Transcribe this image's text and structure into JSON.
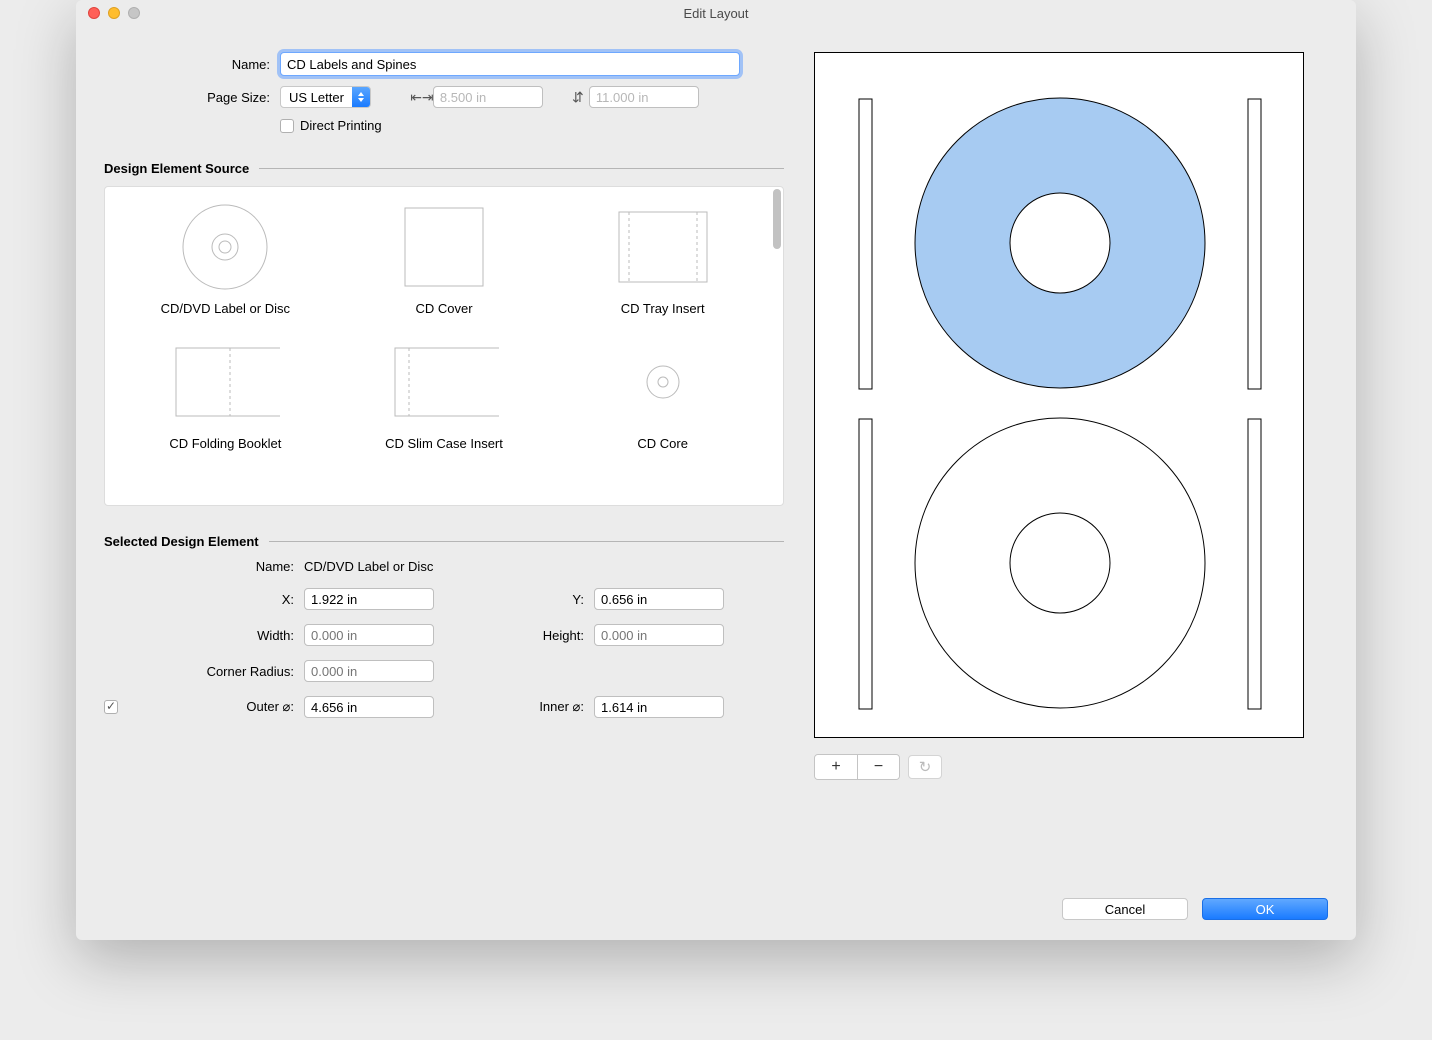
{
  "window": {
    "title": "Edit Layout"
  },
  "header": {
    "name_label": "Name:",
    "name_value": "CD Labels and Spines",
    "page_size_label": "Page Size:",
    "page_size_value": "US Letter",
    "width_value": "8.500 in",
    "height_value": "11.000 in",
    "direct_printing_label": "Direct Printing",
    "direct_printing_checked": false
  },
  "source": {
    "heading": "Design Element Source",
    "items": [
      {
        "label": "CD/DVD Label or Disc"
      },
      {
        "label": "CD Cover"
      },
      {
        "label": "CD Tray Insert"
      },
      {
        "label": "CD Folding Booklet"
      },
      {
        "label": "CD Slim Case Insert"
      },
      {
        "label": "CD Core"
      }
    ]
  },
  "selected": {
    "heading": "Selected Design Element",
    "name_label": "Name:",
    "name_value": "CD/DVD Label or Disc",
    "x_label": "X:",
    "x_value": "1.922 in",
    "y_label": "Y:",
    "y_value": "0.656 in",
    "width_label": "Width:",
    "width_ph": "0.000 in",
    "height_label": "Height:",
    "height_ph": "0.000 in",
    "corner_label": "Corner Radius:",
    "corner_ph": "0.000 in",
    "diam_checked": true,
    "outer_label": "Outer ⌀:",
    "outer_value": "4.656 in",
    "inner_label": "Inner ⌀:",
    "inner_value": "1.614 in"
  },
  "stepper": {
    "plus": "+",
    "minus": "−",
    "redo": "↻"
  },
  "footer": {
    "cancel": "Cancel",
    "ok": "OK"
  }
}
